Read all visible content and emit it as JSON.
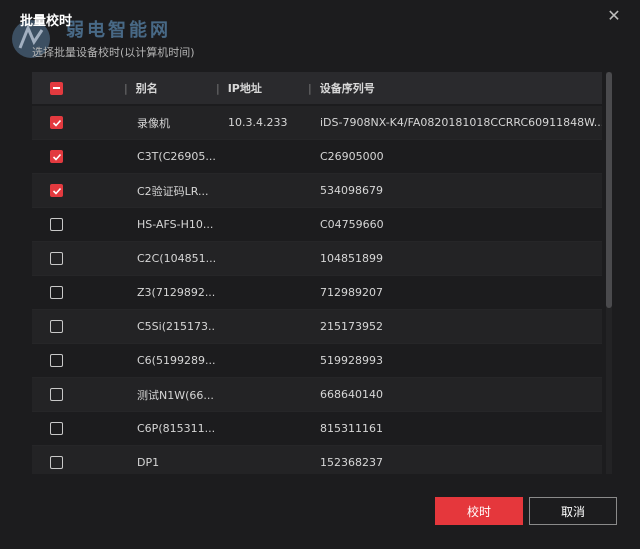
{
  "dialog": {
    "title": "批量校时",
    "subtitle": "选择批量设备校时(以计算机时间)",
    "close_glyph": "✕",
    "watermark": "弱电智能网"
  },
  "table": {
    "headers": {
      "name": "别名",
      "ip": "IP地址",
      "serial": "设备序列号"
    },
    "select_all_state": "partial",
    "rows": [
      {
        "checked": true,
        "name": "录像机",
        "ip": "10.3.4.233",
        "serial": "iDS-7908NX-K4/FA0820181018CCRRC60911848W..."
      },
      {
        "checked": true,
        "name": "C3T(C26905...",
        "ip": "",
        "serial": "C26905000"
      },
      {
        "checked": true,
        "name": "C2验证码LR...",
        "ip": "",
        "serial": "534098679"
      },
      {
        "checked": false,
        "name": "HS-AFS-H10...",
        "ip": "",
        "serial": "C04759660"
      },
      {
        "checked": false,
        "name": "C2C(104851...",
        "ip": "",
        "serial": "104851899"
      },
      {
        "checked": false,
        "name": "Z3(7129892...",
        "ip": "",
        "serial": "712989207"
      },
      {
        "checked": false,
        "name": "C5Si(215173...",
        "ip": "",
        "serial": "215173952"
      },
      {
        "checked": false,
        "name": "C6(5199289...",
        "ip": "",
        "serial": "519928993"
      },
      {
        "checked": false,
        "name": "测试N1W(66...",
        "ip": "",
        "serial": "668640140"
      },
      {
        "checked": false,
        "name": "C6P(815311...",
        "ip": "",
        "serial": "815311161"
      },
      {
        "checked": false,
        "name": "DP1",
        "ip": "",
        "serial": "152368237"
      }
    ]
  },
  "buttons": {
    "ok": "校时",
    "cancel": "取消"
  },
  "colors": {
    "accent": "#e5373c",
    "background": "#1c1c1e",
    "header": "#2a2a2d"
  }
}
